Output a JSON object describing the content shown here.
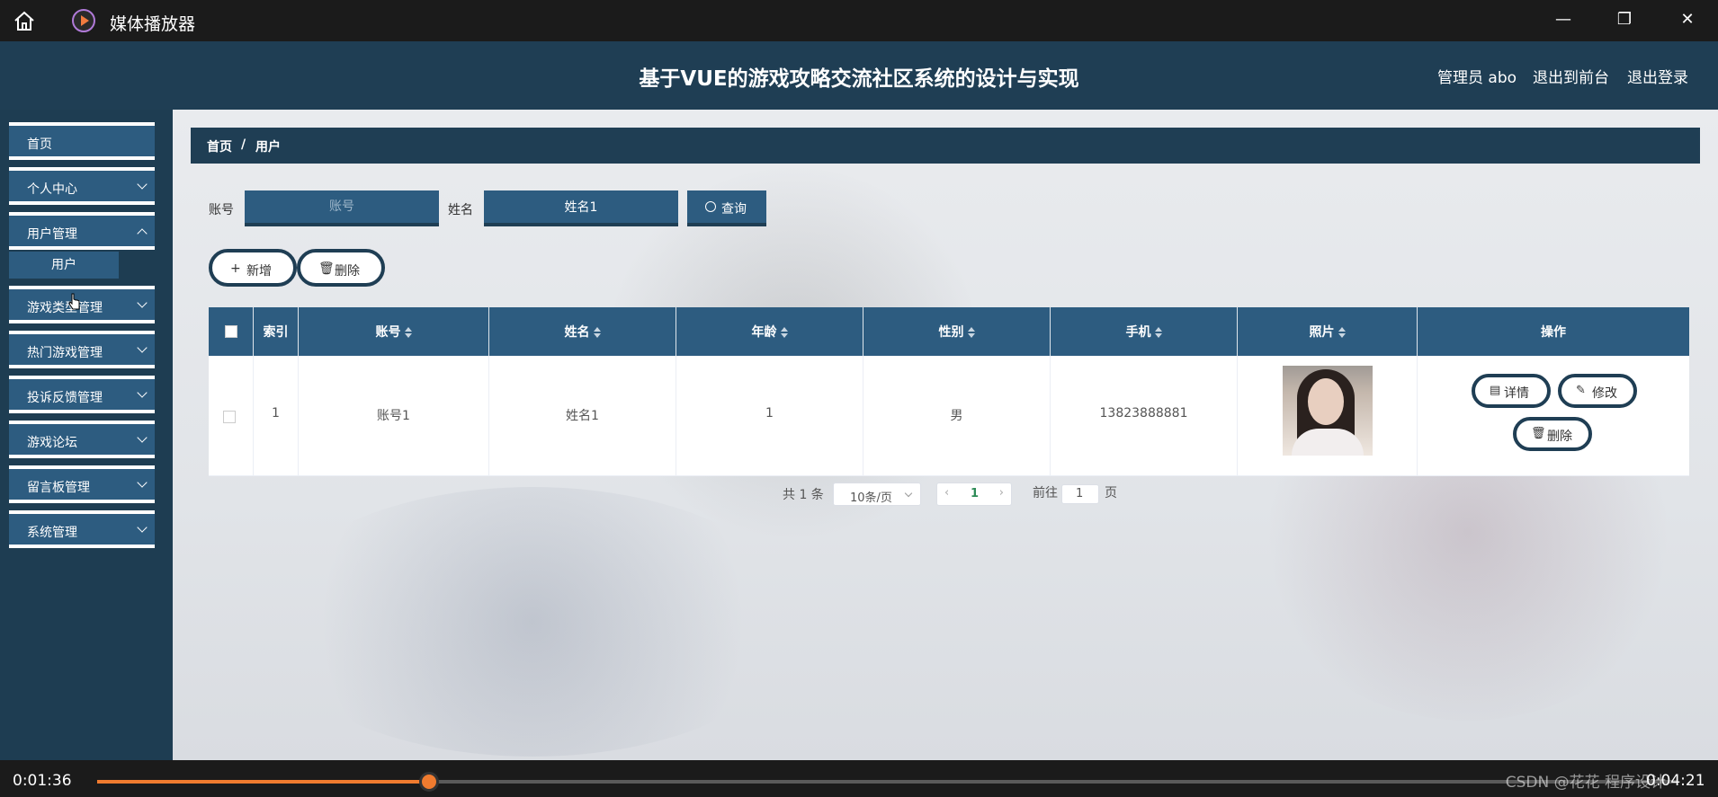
{
  "titlebar": {
    "app_title": "媒体播放器",
    "icons": [
      "home-icon",
      "media-player-icon",
      "minimize-icon",
      "restore-icon",
      "close-icon"
    ]
  },
  "header": {
    "title": "基于VUE的游戏攻略交流社区系统的设计与实现",
    "admin": "管理员 abo",
    "goto_front": "退出到前台",
    "logout": "退出登录"
  },
  "sidebar": {
    "items": [
      {
        "label": "首页",
        "expandable": false
      },
      {
        "label": "个人中心",
        "expandable": true
      },
      {
        "label": "用户管理",
        "expandable": true
      },
      {
        "label": "游戏类型管理",
        "expandable": true
      },
      {
        "label": "热门游戏管理",
        "expandable": true
      },
      {
        "label": "投诉反馈管理",
        "expandable": true
      },
      {
        "label": "游戏论坛",
        "expandable": true
      },
      {
        "label": "留言板管理",
        "expandable": true
      },
      {
        "label": "系统管理",
        "expandable": true
      }
    ],
    "sub_item": "用户"
  },
  "breadcrumb": {
    "home": "首页",
    "sep": "/",
    "current": "用户"
  },
  "search": {
    "account_label": "账号",
    "account_placeholder": "账号",
    "name_label": "姓名",
    "name_value": "姓名1",
    "query_label": "查询"
  },
  "actions": {
    "add": "新增",
    "delete": "删除"
  },
  "table": {
    "columns": [
      "索引",
      "账号",
      "姓名",
      "年龄",
      "性别",
      "手机",
      "照片",
      "操作"
    ],
    "rows": [
      {
        "index": "1",
        "account": "账号1",
        "name": "姓名1",
        "age": "1",
        "gender": "男",
        "phone": "13823888881"
      }
    ],
    "row_actions": {
      "detail": "详情",
      "edit": "修改",
      "delete": "删除"
    }
  },
  "pagination": {
    "total": "共 1 条",
    "page_size": "10条/页",
    "current_page": "1",
    "goto_label": "前往",
    "goto_value": "1",
    "page_unit": "页"
  },
  "player": {
    "elapsed": "0:01:36",
    "duration": "0:04:21",
    "progress": 0.21,
    "watermark": "CSDN @花花 程序设计"
  },
  "colors": {
    "accent": "#2d5c80",
    "header": "#1f3e54",
    "progress": "#f07b2f"
  }
}
